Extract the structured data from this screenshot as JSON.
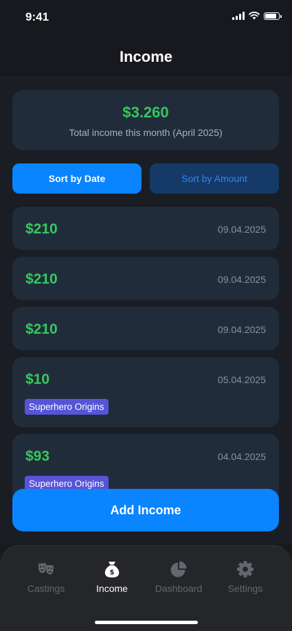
{
  "status_bar": {
    "time": "9:41"
  },
  "header": {
    "title": "Income"
  },
  "summary": {
    "total": "$3.260",
    "caption": "Total income this month (April 2025)"
  },
  "sort": {
    "by_date": "Sort by Date",
    "by_amount": "Sort by Amount",
    "active": "date"
  },
  "income_items": [
    {
      "amount": "$210",
      "date": "09.04.2025",
      "tag": ""
    },
    {
      "amount": "$210",
      "date": "09.04.2025",
      "tag": ""
    },
    {
      "amount": "$210",
      "date": "09.04.2025",
      "tag": ""
    },
    {
      "amount": "$10",
      "date": "05.04.2025",
      "tag": "Superhero Origins"
    },
    {
      "amount": "$93",
      "date": "04.04.2025",
      "tag": "Superhero Origins"
    }
  ],
  "add_button": {
    "label": "Add Income"
  },
  "tab_bar": {
    "items": [
      {
        "label": "Castings",
        "icon": "theater-masks-icon",
        "active": false
      },
      {
        "label": "Income",
        "icon": "money-bag-icon",
        "active": true
      },
      {
        "label": "Dashboard",
        "icon": "pie-chart-icon",
        "active": false
      },
      {
        "label": "Settings",
        "icon": "gear-icon",
        "active": false
      }
    ]
  },
  "colors": {
    "accent": "#0a84ff",
    "income_green": "#35c85f",
    "tag_purple": "#5754d8",
    "card": "#212c3a",
    "background": "#18191e"
  }
}
